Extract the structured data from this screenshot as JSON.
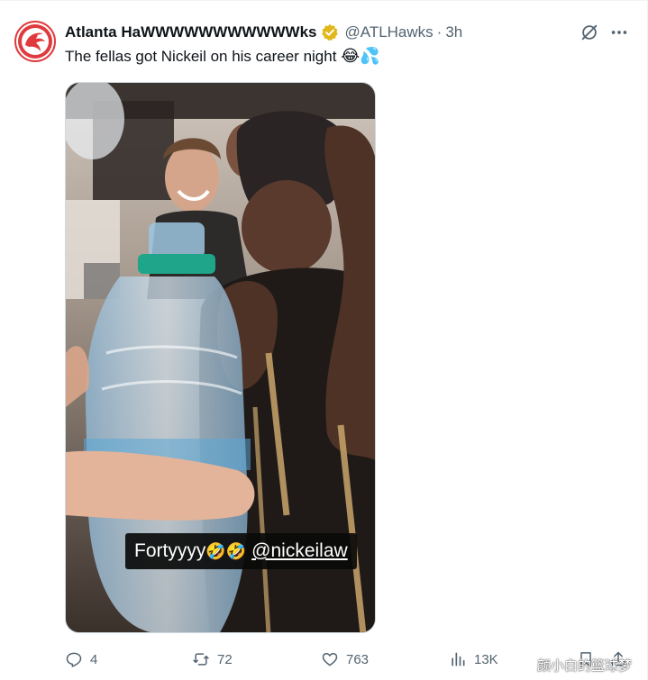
{
  "author": {
    "display_name": "Atlanta HaWWWWWWWWWWWks",
    "handle": "@ATLHawks",
    "separator": "·",
    "time": "3h",
    "verified_color": "#e2b719",
    "brand_color": "#e03a3e"
  },
  "tweet": {
    "text": "The fellas got Nickeil on his career night",
    "text_emojis": "😂💦"
  },
  "media": {
    "caption_text": "Fortyyyy",
    "caption_emojis": "🤣🤣",
    "caption_mention": "@nickeilaw"
  },
  "actions": {
    "replies": "4",
    "reposts": "72",
    "likes": "763",
    "views": "13K"
  },
  "watermark": "颜小白的篮球梦",
  "colors": {
    "secondary_text": "#536471",
    "primary_text": "#0f1419",
    "border": "#eff3f4"
  },
  "icons": [
    "hawks-logo-icon",
    "verified-badge-icon",
    "grok-icon",
    "more-icon",
    "reply-icon",
    "repost-icon",
    "like-icon",
    "views-icon",
    "bookmark-icon",
    "share-icon"
  ]
}
